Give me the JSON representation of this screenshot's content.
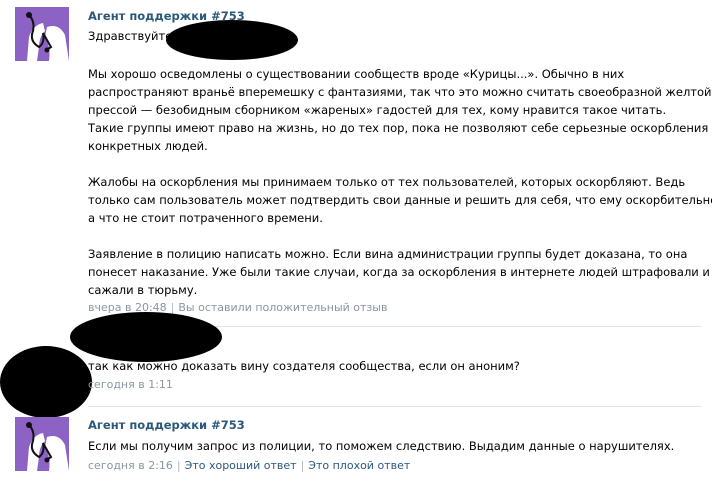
{
  "messages": [
    {
      "author": "Агент поддержки #753",
      "greeting": "Здравствуйте,",
      "lines": [
        "Мы хорошо осведомлены о существовании сообществ вроде «Курицы...». Обычно в них",
        "распространяют враньё вперемешку с фантазиями, так что это можно считать своеобразной желтой",
        "прессой — безобидным сборником «жареных» гадостей для тех, кому нравится такое читать.",
        "Такие группы имеют право на жизнь, но до тех пор, пока не позволяют себе серьезные оскорбления",
        "конкретных людей.",
        "Жалобы на оскорбления мы принимаем только от тех пользователей, которых оскорбляют. Ведь",
        "только сам пользователь может подтвердить свои данные и решить для себя, что ему оскорбительно,",
        "а что не стоит потраченного времени.",
        "Заявление в полицию написать можно. Если вина администрации группы будет доказана, то она",
        "понесет наказание. Уже были такие случаи, когда за оскорбления в интернете людей штрафовали и",
        "сажали в тюрьму."
      ],
      "time": "вчера в 20:48",
      "feedback": "Вы оставили положительный отзыв"
    },
    {
      "text": "так как можно доказать вину создателя сообщества, если он аноним?",
      "time": "сегодня в 1:11"
    },
    {
      "author": "Агент поддержки #753",
      "text": "Если мы получим запрос из полиции, то поможем следствию. Выдадим данные о нарушителях.",
      "time": "сегодня в 2:16",
      "good_answer": "Это хороший ответ",
      "bad_answer": "Это плохой ответ"
    }
  ],
  "colors": {
    "link": "#2b587a",
    "meta": "#8a96a3",
    "divider": "#dfe4ea",
    "avatar_bg": "#8c62c4"
  },
  "icons": {
    "agent_avatar": "support-agent-avatar-icon"
  }
}
